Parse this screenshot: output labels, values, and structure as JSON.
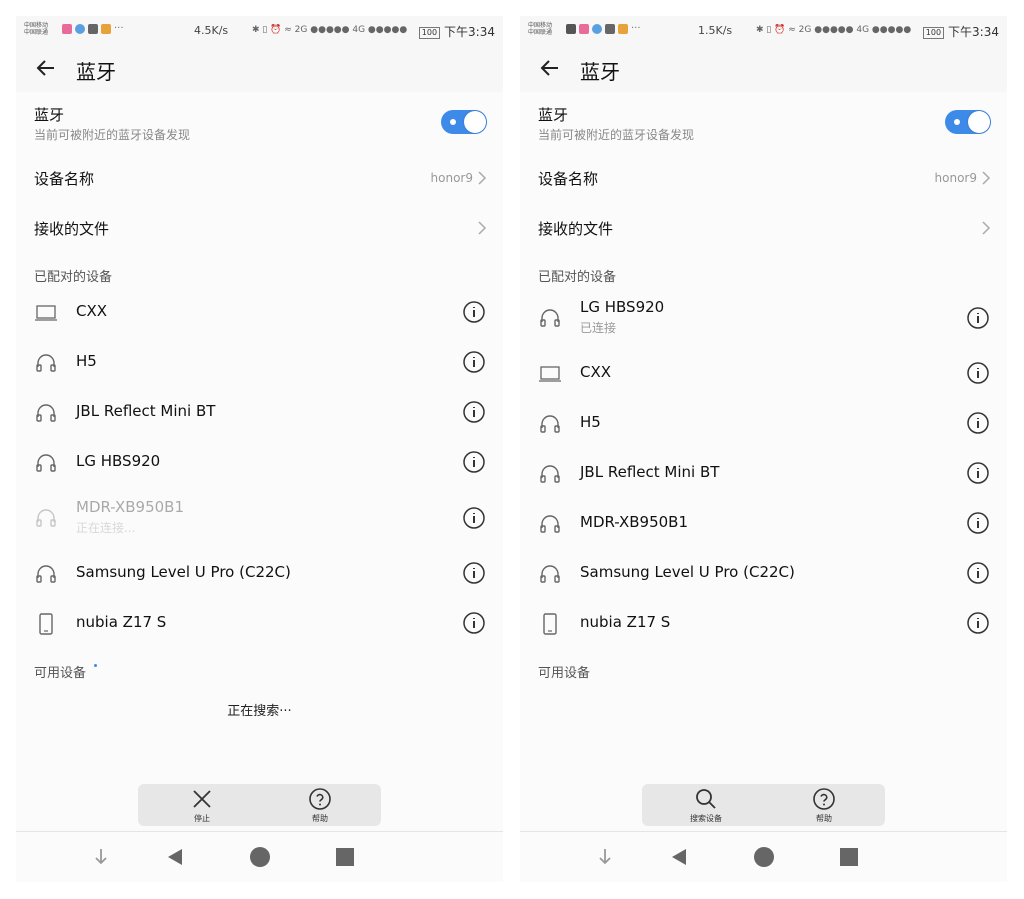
{
  "screens": [
    {
      "status": {
        "carrier1": "中国移动",
        "carrier2": "中国联通",
        "more": "···",
        "speed": "4.5K/s",
        "sicons": "✱ ▯ ⏰ ≈ 2G ●●●●● 4G ●●●●●",
        "battery": "100",
        "time": "下午3:34"
      },
      "header": {
        "title": "蓝牙"
      },
      "bluetooth": {
        "label": "蓝牙",
        "sublabel": "当前可被附近的蓝牙设备发现"
      },
      "device_name": {
        "label": "设备名称",
        "value": "honor9"
      },
      "received_files": {
        "label": "接收的文件"
      },
      "paired_section": "已配对的设备",
      "devices": [
        {
          "name": "CXX",
          "sub": "",
          "icon": "laptop-icon"
        },
        {
          "name": "H5",
          "sub": "",
          "icon": "headphones-icon"
        },
        {
          "name": "JBL Reflect Mini BT",
          "sub": "",
          "icon": "headphones-icon"
        },
        {
          "name": "LG HBS920",
          "sub": "",
          "icon": "headphones-icon"
        },
        {
          "name": "MDR-XB950B1",
          "sub": "正在连接...",
          "icon": "headphones-icon"
        },
        {
          "name": "Samsung Level U Pro (C22C)",
          "sub": "",
          "icon": "headphones-icon"
        },
        {
          "name": "nubia Z17 S",
          "sub": "",
          "icon": "phone-icon"
        }
      ],
      "available_section": "可用设备",
      "searching_text": "正在搜索···",
      "toolbar": {
        "btn1": "停止",
        "btn1_icon": "close-icon",
        "btn2": "帮助",
        "btn2_icon": "help-icon"
      }
    },
    {
      "status": {
        "carrier1": "中国移动",
        "carrier2": "中国联通",
        "more": "···",
        "speed": "1.5K/s",
        "sicons": "✱ ▯ ⏰ ≈ 2G ●●●●● 4G ●●●●●",
        "battery": "100",
        "time": "下午3:34"
      },
      "header": {
        "title": "蓝牙"
      },
      "bluetooth": {
        "label": "蓝牙",
        "sublabel": "当前可被附近的蓝牙设备发现"
      },
      "device_name": {
        "label": "设备名称",
        "value": "honor9"
      },
      "received_files": {
        "label": "接收的文件"
      },
      "paired_section": "已配对的设备",
      "devices": [
        {
          "name": "LG HBS920",
          "sub": "已连接",
          "icon": "headphones-icon"
        },
        {
          "name": "CXX",
          "sub": "",
          "icon": "laptop-icon"
        },
        {
          "name": "H5",
          "sub": "",
          "icon": "headphones-icon"
        },
        {
          "name": "JBL Reflect Mini BT",
          "sub": "",
          "icon": "headphones-icon"
        },
        {
          "name": "MDR-XB950B1",
          "sub": "",
          "icon": "headphones-icon"
        },
        {
          "name": "Samsung Level U Pro (C22C)",
          "sub": "",
          "icon": "headphones-icon"
        },
        {
          "name": "nubia Z17 S",
          "sub": "",
          "icon": "phone-icon"
        }
      ],
      "available_section": "可用设备",
      "toolbar": {
        "btn1": "搜索设备",
        "btn1_icon": "search-icon",
        "btn2": "帮助",
        "btn2_icon": "help-icon"
      }
    }
  ],
  "colors": {
    "accent": "#3d8ae8",
    "background": "#f7f7f7"
  }
}
